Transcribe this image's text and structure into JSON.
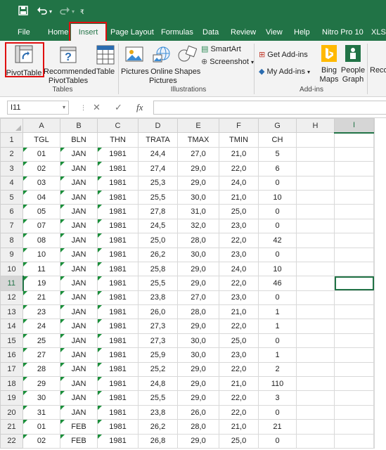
{
  "quick_access": {
    "save_icon": "save-icon",
    "undo_icon": "undo-icon",
    "redo_icon": "redo-icon",
    "customize_icon": "customize-icon"
  },
  "tabs": [
    {
      "label": "File"
    },
    {
      "label": "Home"
    },
    {
      "label": "Insert"
    },
    {
      "label": "Page Layout"
    },
    {
      "label": "Formulas"
    },
    {
      "label": "Data"
    },
    {
      "label": "Review"
    },
    {
      "label": "View"
    },
    {
      "label": "Help"
    },
    {
      "label": "Nitro Pro 10"
    },
    {
      "label": "XLST"
    }
  ],
  "ribbon": {
    "tables": {
      "pivottable": "PivotTable",
      "recommended_1": "Recommended",
      "recommended_2": "PivotTables",
      "table": "Table",
      "label": "Tables"
    },
    "illustrations": {
      "pictures": "Pictures",
      "online_1": "Online",
      "online_2": "Pictures",
      "shapes": "Shapes",
      "smartart": "SmartArt",
      "screenshot": "Screenshot",
      "label": "Illustrations"
    },
    "addins": {
      "get_addins": "Get Add-ins",
      "my_addins": "My Add-ins",
      "bing_1": "Bing",
      "bing_2": "Maps",
      "people_1": "People",
      "people_2": "Graph",
      "label": "Add-ins"
    },
    "reco_cut": "Reco"
  },
  "formula_bar": {
    "name_box": "I11",
    "fx": "fx",
    "cancel": "✕",
    "enter": "✓",
    "value": ""
  },
  "colors": {
    "excel_green": "#217346",
    "highlight_red": "#e01010",
    "error_triangle": "#1a8f3a"
  },
  "columns": [
    "A",
    "B",
    "C",
    "D",
    "E",
    "F",
    "G",
    "H",
    "I"
  ],
  "selected_column": "I",
  "selected_row": 11,
  "headers": [
    "TGL",
    "BLN",
    "THN",
    "TRATA",
    "TMAX",
    "TMIN",
    "CH"
  ],
  "rows": [
    [
      "01",
      "JAN",
      "1981",
      "24,4",
      "27,0",
      "21,0",
      "5"
    ],
    [
      "02",
      "JAN",
      "1981",
      "27,4",
      "29,0",
      "22,0",
      "6"
    ],
    [
      "03",
      "JAN",
      "1981",
      "25,3",
      "29,0",
      "24,0",
      "0"
    ],
    [
      "04",
      "JAN",
      "1981",
      "25,5",
      "30,0",
      "21,0",
      "10"
    ],
    [
      "05",
      "JAN",
      "1981",
      "27,8",
      "31,0",
      "25,0",
      "0"
    ],
    [
      "07",
      "JAN",
      "1981",
      "24,5",
      "32,0",
      "23,0",
      "0"
    ],
    [
      "08",
      "JAN",
      "1981",
      "25,0",
      "28,0",
      "22,0",
      "42"
    ],
    [
      "10",
      "JAN",
      "1981",
      "26,2",
      "30,0",
      "23,0",
      "0"
    ],
    [
      "11",
      "JAN",
      "1981",
      "25,8",
      "29,0",
      "24,0",
      "10"
    ],
    [
      "19",
      "JAN",
      "1981",
      "25,5",
      "29,0",
      "22,0",
      "46"
    ],
    [
      "21",
      "JAN",
      "1981",
      "23,8",
      "27,0",
      "23,0",
      "0"
    ],
    [
      "23",
      "JAN",
      "1981",
      "26,0",
      "28,0",
      "21,0",
      "1"
    ],
    [
      "24",
      "JAN",
      "1981",
      "27,3",
      "29,0",
      "22,0",
      "1"
    ],
    [
      "25",
      "JAN",
      "1981",
      "27,3",
      "30,0",
      "25,0",
      "0"
    ],
    [
      "27",
      "JAN",
      "1981",
      "25,9",
      "30,0",
      "23,0",
      "1"
    ],
    [
      "28",
      "JAN",
      "1981",
      "25,2",
      "29,0",
      "22,0",
      "2"
    ],
    [
      "29",
      "JAN",
      "1981",
      "24,8",
      "29,0",
      "21,0",
      "110"
    ],
    [
      "30",
      "JAN",
      "1981",
      "25,5",
      "29,0",
      "22,0",
      "3"
    ],
    [
      "31",
      "JAN",
      "1981",
      "23,8",
      "26,0",
      "22,0",
      "0"
    ],
    [
      "01",
      "FEB",
      "1981",
      "26,2",
      "28,0",
      "21,0",
      "21"
    ],
    [
      "02",
      "FEB",
      "1981",
      "26,8",
      "29,0",
      "25,0",
      "0"
    ]
  ]
}
